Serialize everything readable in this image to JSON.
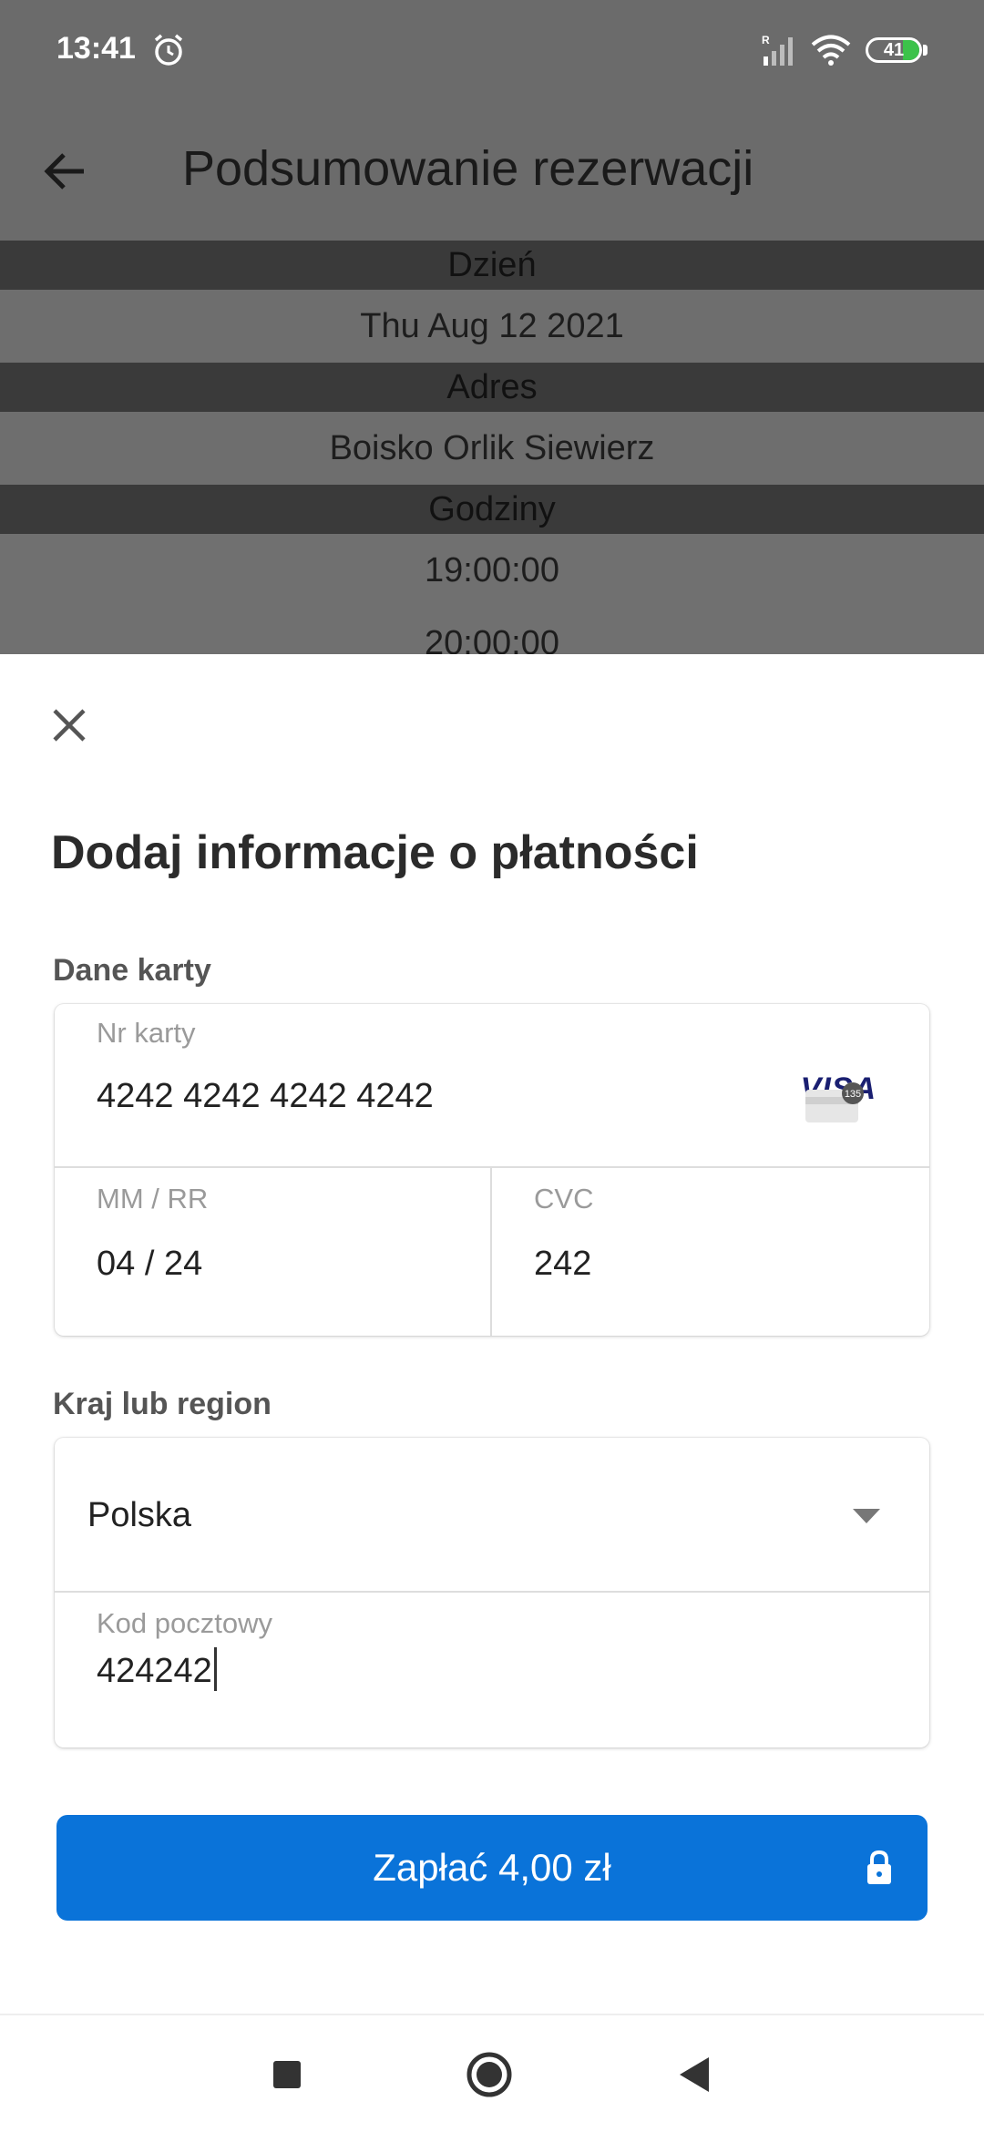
{
  "status_bar": {
    "time": "13:41",
    "battery": "41",
    "icons": [
      "alarm-icon",
      "signal-icon",
      "wifi-icon",
      "battery-icon"
    ]
  },
  "app_bar": {
    "title": "Podsumowanie rezerwacji",
    "back_icon": "arrow-left-icon"
  },
  "summary": {
    "day_label": "Dzień",
    "day_value": "Thu Aug 12 2021",
    "address_label": "Adres",
    "address_value": "Boisko Orlik Siewierz",
    "hours_label": "Godziny",
    "hours": [
      "19:00:00",
      "20:00:00"
    ]
  },
  "sheet": {
    "title": "Dodaj informacje o płatności",
    "card_section_label": "Dane karty",
    "card_number_label": "Nr karty",
    "card_number": "4242 4242 4242 4242",
    "card_brand": "VISA",
    "expiry_label": "MM / RR",
    "expiry_value": "04 / 24",
    "cvc_label": "CVC",
    "cvc_value": "242",
    "cvc_icon_text": "135",
    "region_section_label": "Kraj lub region",
    "country_value": "Polska",
    "postal_label": "Kod pocztowy",
    "postal_value": "424242",
    "pay_button": "Zapłać 4,00 zł"
  },
  "colors": {
    "accent": "#0a73d9",
    "dim_overlay": "#6b6b6b",
    "visa": "#1a1f71"
  }
}
